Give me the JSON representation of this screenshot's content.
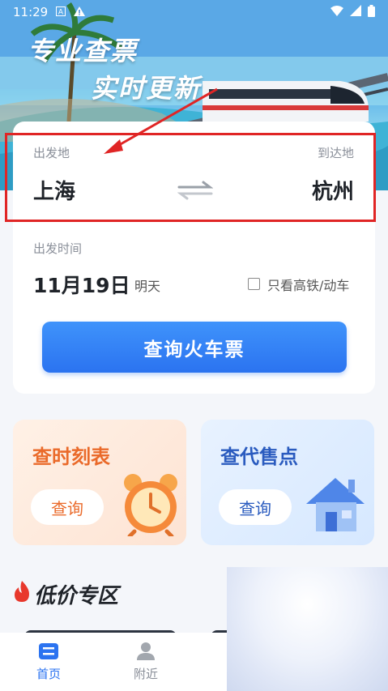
{
  "status_bar": {
    "time": "11:29",
    "notification_icons": [
      "notification-a-icon",
      "warning-icon"
    ],
    "system_icons": [
      "wifi-icon",
      "signal-icon",
      "battery-icon"
    ]
  },
  "hero": {
    "slogan_line1": "专业查票",
    "slogan_line2": "实时更新"
  },
  "search_card": {
    "departure_label": "出发地",
    "departure_city": "上海",
    "arrival_label": "到达地",
    "arrival_city": "杭州",
    "swap_icon": "swap-arrows-icon",
    "date_label": "出发时间",
    "date_value": "11月19日",
    "date_hint": "明天",
    "high_speed_only_label": "只看高铁/动车",
    "high_speed_only_checked": false,
    "search_button_label": "查询火车票"
  },
  "feature_cards": {
    "timetable": {
      "title": "查时刻表",
      "button": "查询",
      "icon": "alarm-clock-icon"
    },
    "ticket_agency": {
      "title": "查代售点",
      "button": "查询",
      "icon": "house-icon"
    }
  },
  "low_price_section": {
    "title": "低价专区",
    "icon": "flame-icon"
  },
  "tab_bar": {
    "home": {
      "label": "首页",
      "icon": "home-tab-icon",
      "active": true
    },
    "nearby": {
      "label": "附近",
      "icon": "person-location-icon",
      "active": false
    }
  },
  "colors": {
    "accent_blue": "#2b73f0",
    "highlight_red": "#e02525",
    "timetable_title": "#ea6a2a",
    "agency_title": "#2a5bbf"
  }
}
